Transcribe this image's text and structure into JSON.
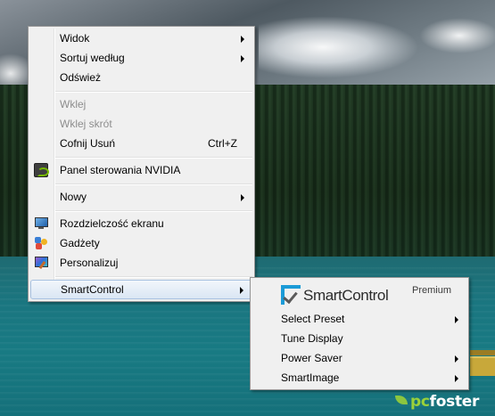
{
  "context_menu": {
    "items": [
      {
        "label": "Widok",
        "submenu": true
      },
      {
        "label": "Sortuj według",
        "submenu": true
      },
      {
        "label": "Odśwież"
      },
      {
        "label": "Wklej",
        "disabled": true
      },
      {
        "label": "Wklej skrót",
        "disabled": true
      },
      {
        "label": "Cofnij Usuń",
        "shortcut": "Ctrl+Z"
      },
      {
        "label": "Panel sterowania NVIDIA",
        "icon": "nvidia-icon"
      },
      {
        "label": "Nowy",
        "submenu": true
      },
      {
        "label": "Rozdzielczość ekranu",
        "icon": "monitor-icon"
      },
      {
        "label": "Gadżety",
        "icon": "gadgets-icon"
      },
      {
        "label": "Personalizuj",
        "icon": "personalize-icon"
      },
      {
        "label": "SmartControl",
        "submenu": true,
        "highlighted": true
      }
    ]
  },
  "smartcontrol_submenu": {
    "brand_name": "SmartControl",
    "brand_tier": "Premium",
    "items": [
      {
        "label": "Select Preset",
        "submenu": true
      },
      {
        "label": "Tune Display"
      },
      {
        "label": "Power Saver",
        "submenu": true
      },
      {
        "label": "SmartImage",
        "submenu": true
      }
    ]
  },
  "watermark": {
    "prefix": "pc",
    "rest": "foster"
  },
  "colors": {
    "menu_bg": "#f0f0f0",
    "highlight": "#dae6f4",
    "disabled_text": "#8d8d8d",
    "brand_blue": "#1b9bd7",
    "watermark_green": "#9ad13a"
  }
}
